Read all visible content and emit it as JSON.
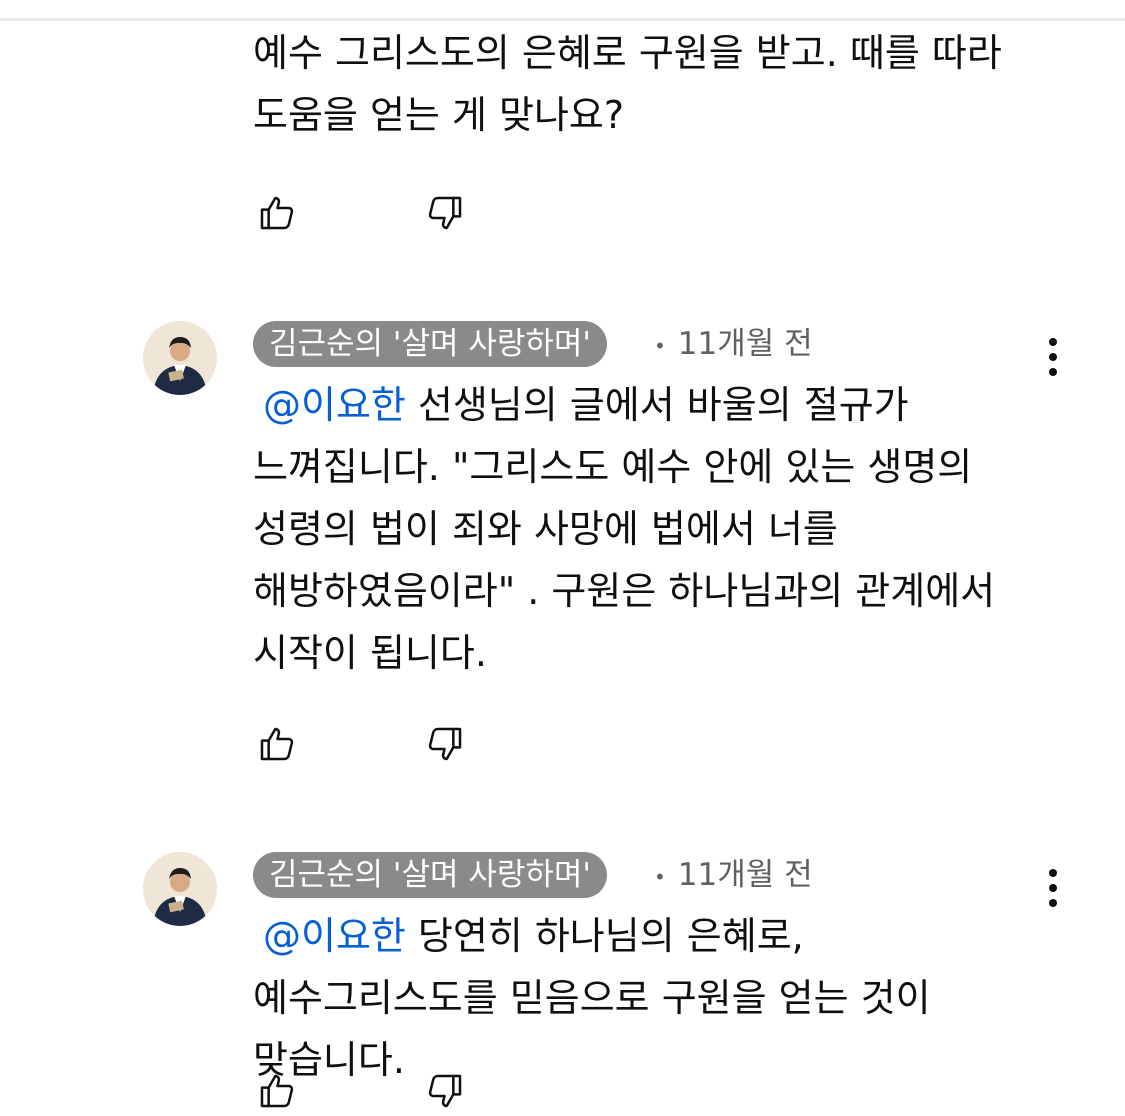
{
  "comments": [
    {
      "text": "예수 그리스도의 은혜로 구원을 받고. 때를 따라 도움을 얻는 게 맞나요?"
    },
    {
      "author": "김근순의 '살며 사랑하며'",
      "time": "11개월 전",
      "mention": "@이요한",
      "text": "선생님의 글에서 바울의 절규가 느껴집니다. \"그리스도 예수 안에 있는 생명의 성령의 법이 죄와 사망에 법에서 너를 해방하였음이라\" . 구원은 하나님과의 관계에서 시작이 됩니다."
    },
    {
      "author": "김근순의 '살며 사랑하며'",
      "time": "11개월 전",
      "mention": "@이요한",
      "text": "당연히 하나님의 은혜로, 예수그리스도를 믿음으로 구원을 얻는 것이 맞습니다."
    }
  ],
  "meta_separator": "•",
  "icons": {
    "like": "thumbs-up-icon",
    "dislike": "thumbs-down-icon",
    "more": "more-vert-icon"
  },
  "colors": {
    "mention": "#065fd4",
    "author_chip_bg": "#8a8a8a",
    "meta_text": "#606060"
  }
}
